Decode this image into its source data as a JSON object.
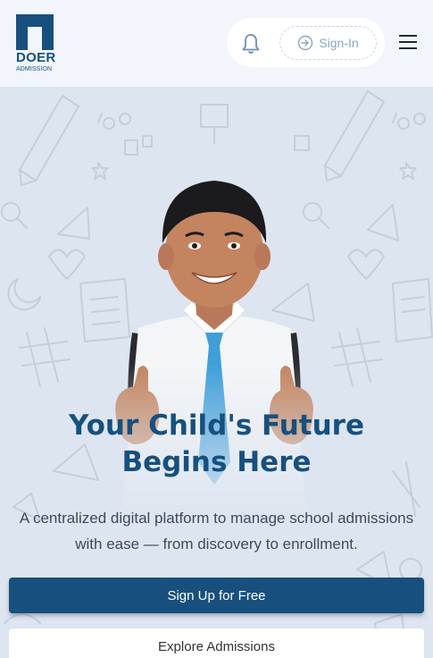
{
  "brand": {
    "name": "DOER",
    "tagline": "ADMISSION",
    "color": "#17507e"
  },
  "header": {
    "signin_label": "Sign-In",
    "icons": [
      "bell-icon",
      "signin-arrow-icon",
      "hamburger-menu-icon"
    ]
  },
  "hero": {
    "title": "Your Child's Future Begins Here",
    "subtitle": "A centralized digital platform to manage school admissions with ease — from discovery to enrollment.",
    "primary_cta": "Sign Up for Free",
    "secondary_cta": "Explore Admissions"
  },
  "colors": {
    "accent": "#17507e",
    "background": "#dfe6f1",
    "header_bg": "#f2f5fb"
  }
}
